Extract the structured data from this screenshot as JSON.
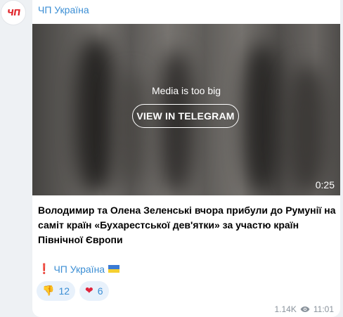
{
  "channel": {
    "avatar_text": "ЧП",
    "name": "ЧП Україна"
  },
  "media": {
    "message": "Media is too big",
    "button_label": "VIEW IN TELEGRAM",
    "duration": "0:25"
  },
  "post": {
    "caption": "Володимир та Олена Зеленські вчора прибули до Румунії на саміт країн «Бухарестської дев'ятки» за участю країн Північної Європи",
    "signature_mark": "❗",
    "signature_link": "ЧП Україна",
    "signature_flag_icon": "ukraine-flag-icon"
  },
  "reactions": [
    {
      "icon": "thumbs-down-icon",
      "emoji": "👎",
      "count": "12"
    },
    {
      "icon": "heart-icon",
      "emoji": "❤",
      "count": "6"
    }
  ],
  "meta": {
    "views": "1.14K",
    "time": "11:01"
  },
  "colors": {
    "accent": "#3b8ed4",
    "background": "#eef1f4",
    "bubble": "#ffffff",
    "reaction_bg": "#e8f1fb"
  }
}
